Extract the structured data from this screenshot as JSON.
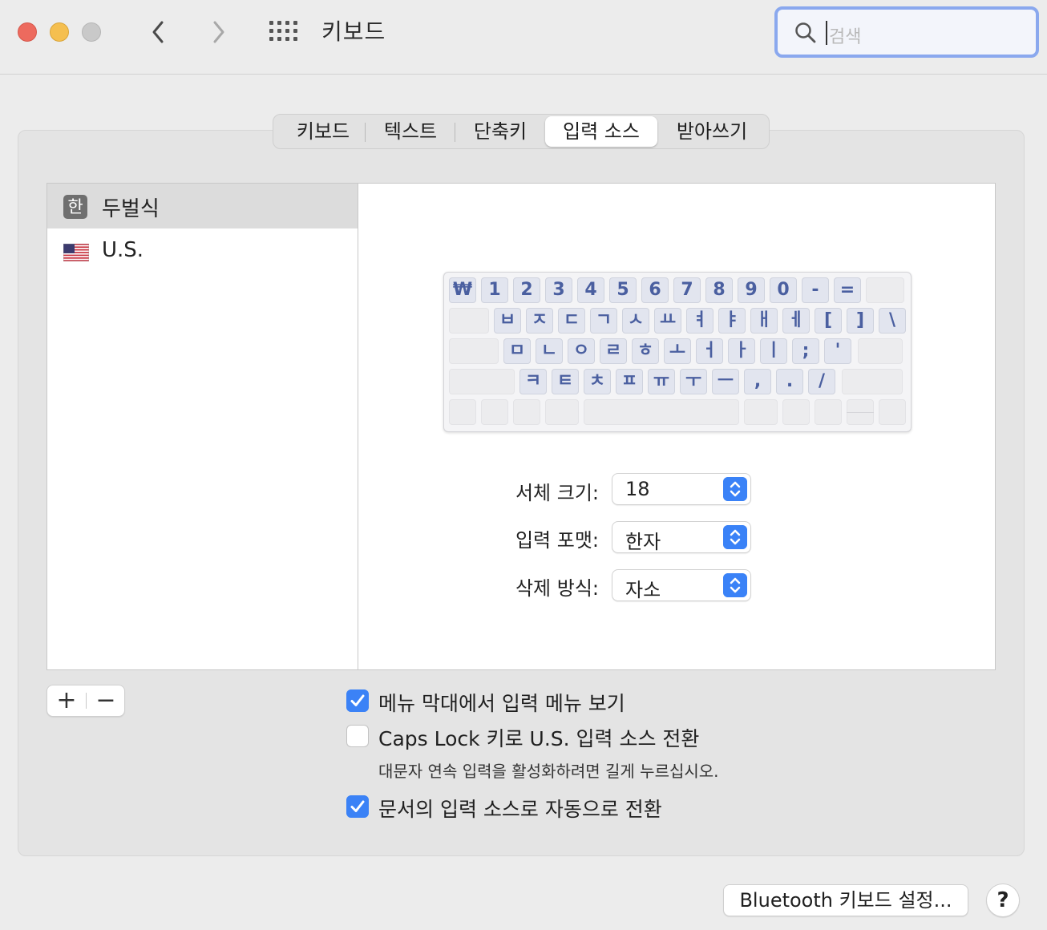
{
  "window": {
    "title": "키보드",
    "search_placeholder": "검색",
    "traffic_lights": [
      "close",
      "minimize",
      "zoom-disabled"
    ]
  },
  "tabs": [
    {
      "label": "키보드",
      "active": false
    },
    {
      "label": "텍스트",
      "active": false
    },
    {
      "label": "단축키",
      "active": false
    },
    {
      "label": "입력 소스",
      "active": true
    },
    {
      "label": "받아쓰기",
      "active": false
    }
  ],
  "sources": [
    {
      "badge": "한",
      "label": "두벌식",
      "selected": true
    },
    {
      "badge": "us-flag-icon",
      "label": "U.S.",
      "selected": false
    }
  ],
  "keyboard": {
    "rows": [
      [
        "₩",
        "1",
        "2",
        "3",
        "4",
        "5",
        "6",
        "7",
        "8",
        "9",
        "0",
        "-",
        "="
      ],
      [
        "ㅂ",
        "ㅈ",
        "ㄷ",
        "ㄱ",
        "ㅅ",
        "ㅛ",
        "ㅕ",
        "ㅑ",
        "ㅐ",
        "ㅔ",
        "[",
        "]",
        "\\"
      ],
      [
        "ㅁ",
        "ㄴ",
        "ㅇ",
        "ㄹ",
        "ㅎ",
        "ㅗ",
        "ㅓ",
        "ㅏ",
        "ㅣ",
        ";",
        "'"
      ],
      [
        "ㅋ",
        "ㅌ",
        "ㅊ",
        "ㅍ",
        "ㅠ",
        "ㅜ",
        "ㅡ",
        ",",
        ".",
        "/"
      ]
    ]
  },
  "settings": [
    {
      "label": "서체 크기:",
      "value": "18"
    },
    {
      "label": "입력 포맷:",
      "value": "한자"
    },
    {
      "label": "삭제 방식:",
      "value": "자소"
    }
  ],
  "list_controls": {
    "add": "+",
    "remove": "−"
  },
  "options": [
    {
      "label": "메뉴 막대에서 입력 메뉴 보기",
      "checked": true
    },
    {
      "label": "Caps Lock 키로 U.S. 입력 소스 전환",
      "checked": false
    },
    {
      "label": "문서의 입력 소스로 자동으로 전환",
      "checked": true
    }
  ],
  "caps_hint": "대문자 연속 입력을 활성화하려면 길게 누르십시오.",
  "footer": {
    "bluetooth_button": "Bluetooth 키보드 설정...",
    "help": "?"
  },
  "colors": {
    "accent": "#3b82f6",
    "search_focus": "#8aa8ee",
    "key_text": "#4a5fa0"
  }
}
